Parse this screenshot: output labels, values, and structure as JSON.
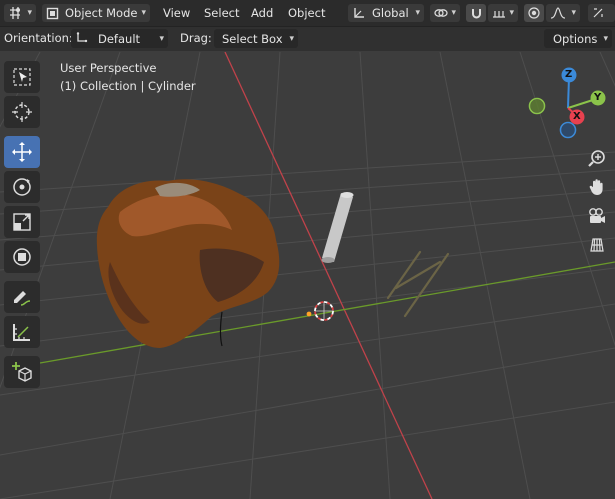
{
  "header": {
    "mode_label": "Object Mode",
    "menus": [
      "View",
      "Select",
      "Add",
      "Object"
    ],
    "transform_orientation": "Global"
  },
  "tool_settings": {
    "orientation_label": "Orientation:",
    "orientation_value": "Default",
    "drag_label": "Drag:",
    "drag_value": "Select Box",
    "options_label": "Options"
  },
  "viewport": {
    "view_name": "User Perspective",
    "collection_info": "(1) Collection | Cylinder"
  },
  "gizmo": {
    "x_label": "X",
    "y_label": "Y",
    "z_label": "Z",
    "x_color": "#e8414f",
    "y_color": "#8bc34a",
    "z_color": "#3b8ad9"
  },
  "icons": {
    "toolbar": [
      "select-box-icon",
      "cursor-icon",
      "move-icon",
      "rotate-icon",
      "scale-icon",
      "transform-icon",
      "annotate-icon",
      "measure-icon",
      "add-cube-icon"
    ],
    "navigation": [
      "zoom-icon",
      "pan-hand-icon",
      "camera-view-icon",
      "grid-ortho-icon"
    ]
  },
  "colors": {
    "active_tool": "#4772b3",
    "x_axis_line": "#c0424a",
    "y_axis_line": "#6a9a2a"
  }
}
